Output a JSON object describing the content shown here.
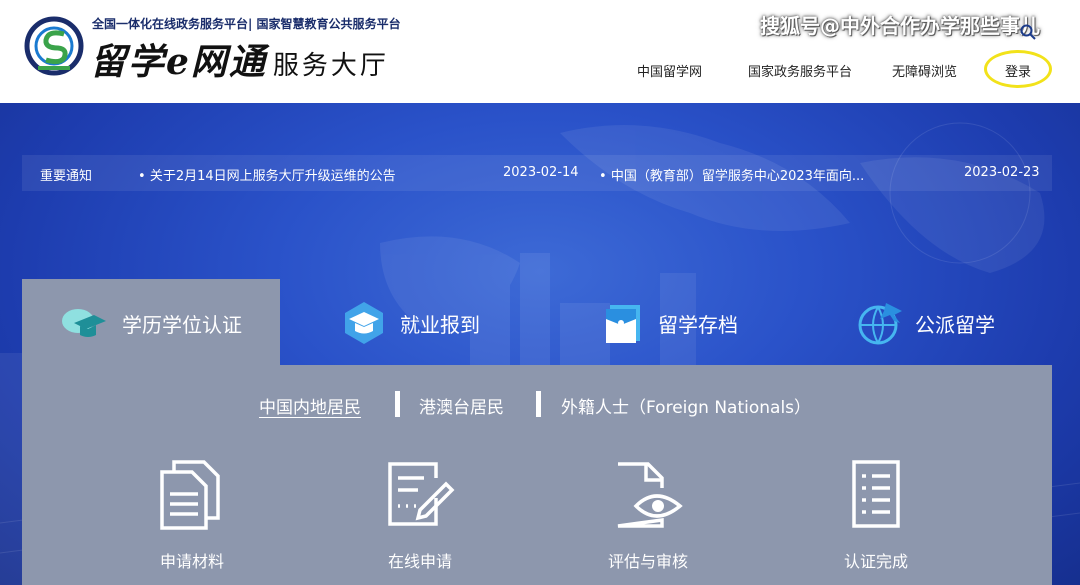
{
  "header": {
    "tagline": "全国一体化在线政务服务平台| 国家智慧教育公共服务平台",
    "brand": "留学e网通",
    "brand_sub": "服务大厅",
    "watermark": "搜狐号@中外合作办学那些事儿",
    "nav": [
      "中国留学网",
      "国家政务服务平台",
      "无障碍浏览",
      "登录"
    ]
  },
  "notices": {
    "label": "重要通知",
    "items": [
      {
        "title": "关于2月14日网上服务大厅升级运维的公告",
        "date": "2023-02-14"
      },
      {
        "title": "中国（教育部）留学服务中心2023年面向...",
        "date": "2023-02-23"
      }
    ]
  },
  "tabs": [
    {
      "label": "学历学位认证",
      "icon": "graduation-cap-icon",
      "active": true
    },
    {
      "label": "就业报到",
      "icon": "hexagon-cap-icon",
      "active": false
    },
    {
      "label": "留学存档",
      "icon": "archive-folder-icon",
      "active": false
    },
    {
      "label": "公派留学",
      "icon": "globe-plane-icon",
      "active": false
    }
  ],
  "sub_tabs": [
    "中国内地居民",
    "港澳台居民",
    "外籍人士（Foreign Nationals）"
  ],
  "steps": [
    {
      "label": "申请材料",
      "icon": "documents-icon"
    },
    {
      "label": "在线申请",
      "icon": "online-form-icon"
    },
    {
      "label": "评估与审核",
      "icon": "review-eye-icon"
    },
    {
      "label": "认证完成",
      "icon": "checklist-icon"
    }
  ],
  "colors": {
    "hero_blue": "#2a52c9",
    "panel_gray": "#8d97ad",
    "login_highlight": "#f2e21a",
    "brand_navy": "#1a2d6b"
  }
}
